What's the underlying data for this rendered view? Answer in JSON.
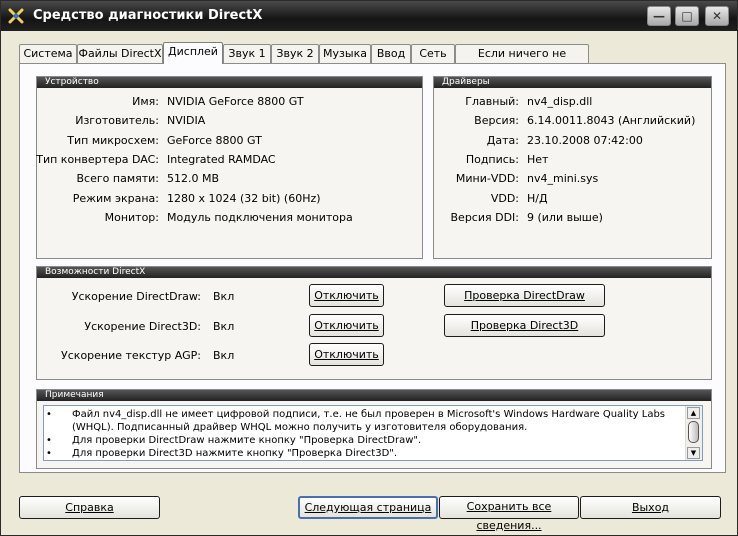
{
  "window": {
    "title": "Средство диагностики DirectX",
    "min_glyph": "—",
    "max_glyph": "□",
    "close_glyph": "✕"
  },
  "tabs": [
    {
      "label": "Система"
    },
    {
      "label": "Файлы DirectX"
    },
    {
      "label": "Дисплей"
    },
    {
      "label": "Звук 1"
    },
    {
      "label": "Звук 2"
    },
    {
      "label": "Музыка"
    },
    {
      "label": "Ввод"
    },
    {
      "label": "Сеть"
    },
    {
      "label": "Если ничего не помогло"
    }
  ],
  "device": {
    "header": "Устройство",
    "rows": [
      {
        "label": "Имя:",
        "value": "NVIDIA GeForce 8800 GT"
      },
      {
        "label": "Изготовитель:",
        "value": "NVIDIA"
      },
      {
        "label": "Тип микросхем:",
        "value": "GeForce 8800 GT"
      },
      {
        "label": "Тип конвертера DAC:",
        "value": "Integrated RAMDAC"
      },
      {
        "label": "Всего памяти:",
        "value": "512.0 MB"
      },
      {
        "label": "Режим экрана:",
        "value": "1280 x 1024 (32 bit) (60Hz)"
      },
      {
        "label": "Монитор:",
        "value": "Модуль подключения монитора"
      }
    ]
  },
  "drivers": {
    "header": "Драйверы",
    "rows": [
      {
        "label": "Главный:",
        "value": "nv4_disp.dll"
      },
      {
        "label": "Версия:",
        "value": "6.14.0011.8043 (Английский)"
      },
      {
        "label": "Дата:",
        "value": "23.10.2008 07:42:00"
      },
      {
        "label": "Подпись:",
        "value": "Нет"
      },
      {
        "label": "Мини-VDD:",
        "value": "nv4_mini.sys"
      },
      {
        "label": "VDD:",
        "value": "Н/Д"
      },
      {
        "label": "Версия DDI:",
        "value": "9 (или выше)"
      }
    ]
  },
  "features": {
    "header": "Возможности DirectX",
    "rows": [
      {
        "label": "Ускорение DirectDraw:",
        "value": "Вкл",
        "button": "Отключить"
      },
      {
        "label": "Ускорение Direct3D:",
        "value": "Вкл",
        "button": "Отключить"
      },
      {
        "label": "Ускорение текстур AGP:",
        "value": "Вкл",
        "button": "Отключить"
      }
    ],
    "test_directdraw": "Проверка DirectDraw",
    "test_direct3d": "Проверка Direct3D"
  },
  "notes": {
    "header": "Примечания",
    "lines": [
      {
        "bullet": "•",
        "text": "Файл nv4_disp.dll не имеет цифровой подписи, т.е. не был проверен в Microsoft's Windows Hardware Quality Labs"
      },
      {
        "bullet": "",
        "text": "(WHQL).  Подписанный драйвер WHQL можно получить у изготовителя оборудования."
      },
      {
        "bullet": "•",
        "text": "Для проверки DirectDraw нажмите кнопку \"Проверка DirectDraw\"."
      },
      {
        "bullet": "•",
        "text": "Для проверки Direct3D нажмите кнопку \"Проверка Direct3D\"."
      }
    ]
  },
  "footer": {
    "help": "Справка",
    "next_page": "Следующая страница",
    "save_all": "Сохранить все сведения...",
    "exit": "Выход"
  }
}
